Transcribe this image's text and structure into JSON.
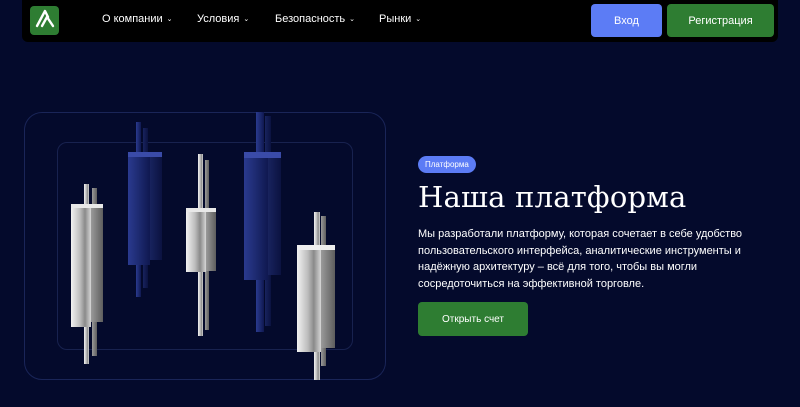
{
  "nav": {
    "logo_icon": "trading-logo-icon",
    "items": [
      {
        "label": "О компании"
      },
      {
        "label": "Условия"
      },
      {
        "label": "Безопасность"
      },
      {
        "label": "Рынки"
      }
    ],
    "login_label": "Вход",
    "register_label": "Регистрация"
  },
  "hero": {
    "badge": "Платформа",
    "title": "Наша платформа",
    "description": "Мы разработали платформу, которая сочетает в себе удобство пользовательского интерфейса, аналитические инструменты и надёжную архитектуру – всё для того, чтобы вы могли сосредоточиться на эффективной торговле.",
    "cta_label": "Открыть счет"
  },
  "colors": {
    "background": "#040a2c",
    "accent_blue": "#5c7cf5",
    "accent_green": "#2e7d32"
  }
}
